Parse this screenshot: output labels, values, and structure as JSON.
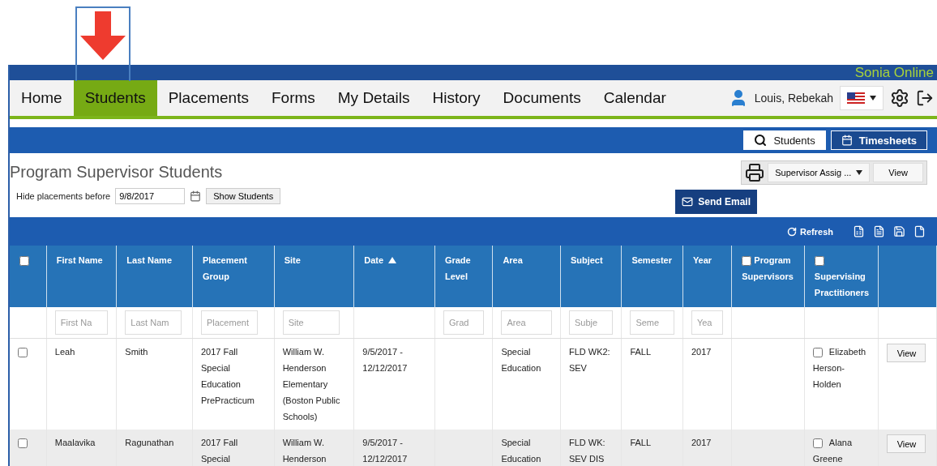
{
  "logo": "Sonia Online",
  "nav": {
    "items": [
      {
        "label": "Home",
        "selected": false
      },
      {
        "label": "Students",
        "selected": true
      },
      {
        "label": "Placements",
        "selected": false
      },
      {
        "label": "Forms",
        "selected": false
      },
      {
        "label": "My Details",
        "selected": false
      },
      {
        "label": "History",
        "selected": false
      },
      {
        "label": "Documents",
        "selected": false
      },
      {
        "label": "Calendar",
        "selected": false
      }
    ],
    "user": "Louis, Rebekah"
  },
  "mode_tabs": [
    {
      "label": "Students",
      "selected": false
    },
    {
      "label": "Timesheets",
      "selected": true
    }
  ],
  "page_title": "Program Supervisor Students",
  "report": {
    "value": "Supervisor Assig ...",
    "button": "View"
  },
  "filter": {
    "label": "Hide placements before",
    "value": "9/8/2017",
    "button": "Show Students"
  },
  "send_email": "Send Email",
  "toolbar": {
    "refresh": "Refresh"
  },
  "table": {
    "select_all_checked": false,
    "columns": [
      {
        "label": "First Name",
        "placeholder": "First Na",
        "sorted": false
      },
      {
        "label": "Last Name",
        "placeholder": "Last Nam",
        "sorted": false
      },
      {
        "label": "Placement Group",
        "placeholder": "Placement",
        "sorted": false
      },
      {
        "label": "Site",
        "placeholder": "Site",
        "sorted": false
      },
      {
        "label": "Date",
        "sorted": true
      },
      {
        "label": "Grade Level",
        "placeholder": "Grad",
        "sorted": false
      },
      {
        "label": "Area",
        "placeholder": "Area",
        "sorted": false
      },
      {
        "label": "Subject",
        "placeholder": "Subje",
        "sorted": false
      },
      {
        "label": "Semester",
        "placeholder": "Seme",
        "sorted": false
      },
      {
        "label": "Year",
        "placeholder": "Yea",
        "sorted": false
      },
      {
        "label": "Program Supervisors",
        "checked": false,
        "sorted": false
      },
      {
        "label": "Supervising Practitioners",
        "checked": false,
        "sorted": false
      }
    ],
    "rows": [
      {
        "checked": false,
        "shaded": false,
        "cells": [
          "Leah",
          "Smith",
          "2017 Fall Special Education PrePracticum",
          "William W. Henderson Elementary (Boston Public Schools)",
          "9/5/2017 - 12/12/2017",
          "",
          "Special Education",
          "FLD WK2: SEV",
          "FALL",
          "2017",
          ""
        ],
        "practitioner": "Elizabeth Herson-Holden",
        "practitioner_checked": false,
        "button": "View"
      },
      {
        "checked": false,
        "shaded": true,
        "cells": [
          "Maalavika",
          "Ragunathan",
          "2017 Fall Special",
          "William W. Henderson",
          "9/5/2017 - 12/12/2017",
          "",
          "Special Education",
          "FLD WK: SEV DIS",
          "FALL",
          "2017",
          ""
        ],
        "practitioner": "Alana Greene",
        "practitioner_checked": false,
        "button": "View"
      }
    ]
  }
}
